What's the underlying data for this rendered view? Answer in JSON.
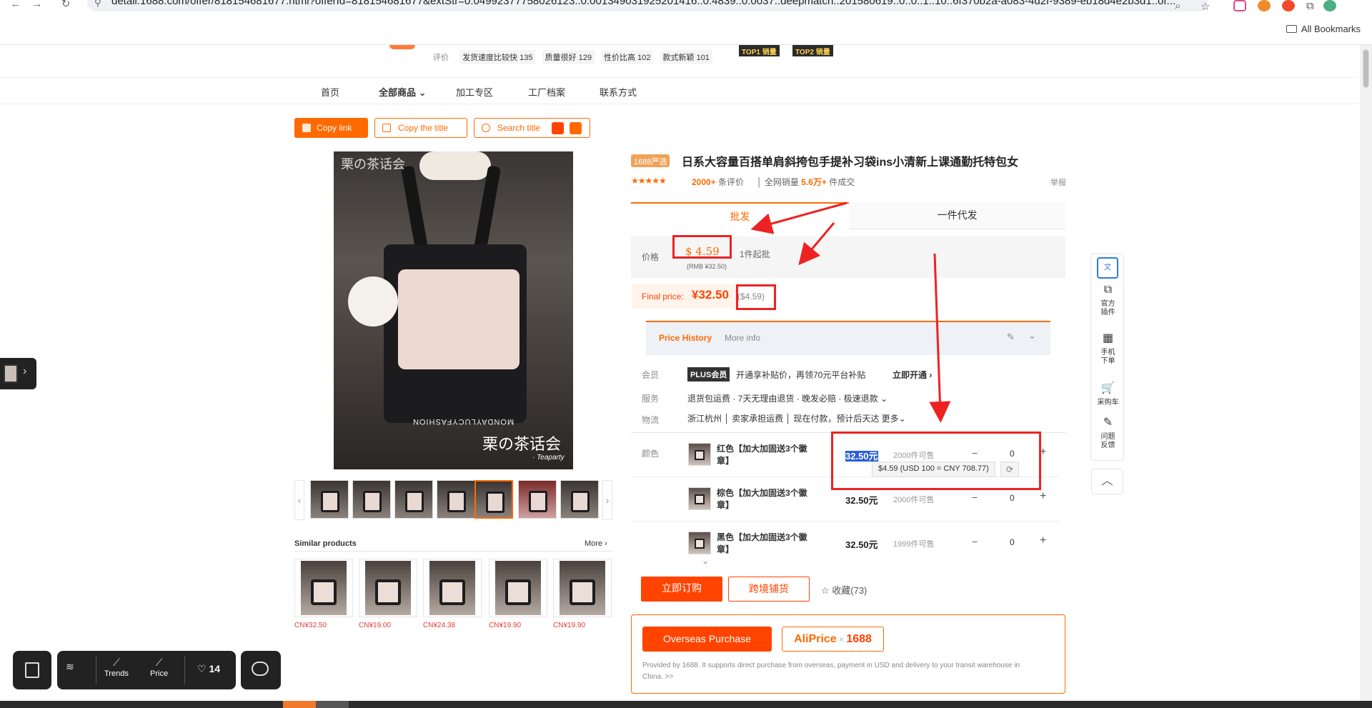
{
  "browser": {
    "url": "detail.1688.com/offer/818154681677.html?offerId=818154681677&extStr=0.04992377758026123..0.001349031925201416..0.4839..0.0037..deepmatch..201580619..0..0..1..10..6f370b2a-a083-4d2f-9389-eb18d4e2b3d1..of...",
    "bookmarks_label": "All Bookmarks"
  },
  "store": {
    "rating_label": "评价",
    "chips": [
      "发货速度比较快 135",
      "质量很好 129",
      "性价比高 102",
      "款式新颖 101"
    ],
    "top_badges": [
      "TOP1 销量",
      "TOP2 销量"
    ],
    "nav": [
      "首页",
      "全部商品",
      "加工专区",
      "工厂档案",
      "联系方式"
    ]
  },
  "toolbar": {
    "copy_link": "Copy link",
    "copy_title": "Copy the title",
    "search_title": "Search title"
  },
  "product": {
    "badge": "1688严选",
    "title": "日系大容量百搭单肩斜挎包手提补习袋ins小清新上课通勤托特包女",
    "stars": "★★★★★",
    "review_count": "2000+",
    "review_suffix": " 条评价",
    "sales_prefix": "全网销量 ",
    "sales_count": "5.6万+",
    "sales_suffix": " 件成交",
    "report": "举报"
  },
  "image": {
    "watermark_top": "栗の茶话会",
    "watermark_main": "栗の茶话会",
    "watermark_sub": "· Teaparty",
    "brand_text": "MONDAYLUCYFASHION"
  },
  "tabs": {
    "wholesale": "批发",
    "dropship": "一件代发"
  },
  "price": {
    "label": "价格",
    "usd": "$ 4.59",
    "rmb_note": "(RMB ¥32.50)",
    "moq": "1件起批",
    "final_label": "Final price:",
    "final_cny": "¥32.50",
    "final_usd": "($4.59)"
  },
  "history": {
    "tab1": "Price History",
    "tab2": "More info"
  },
  "rows": {
    "member_label": "会员",
    "member_badge": "PLUS会员",
    "member_text": "开通享补贴价，再领70元平台补贴",
    "member_cta": "立即开通 ›",
    "service_label": "服务",
    "service_text": "退货包运费 · 7天无理由退货 · 晚发必赔 · 极速退款 ⌄",
    "logistics_label": "物流",
    "logistics_text": "浙江杭州 │ 卖家承担运费 │ 现在付款，预计后天达  更多⌄",
    "color_label": "颜色"
  },
  "skus": [
    {
      "name": "红色【加大加固送3个徽章】",
      "price": "32.50元",
      "stock": "2000件可售",
      "qty": "0"
    },
    {
      "name": "棕色【加大加固送3个徽章】",
      "price": "32.50元",
      "stock": "2000件可售",
      "qty": "0"
    },
    {
      "name": "黑色【加大加固送3个徽章】",
      "price": "32.50元",
      "stock": "1999件可售",
      "qty": "0"
    }
  ],
  "tooltip": "$4.59 (USD 100 = CNY 708.77)",
  "actions": {
    "buy": "立即订购",
    "cross": "跨境铺货",
    "fav": "☆ 收藏(73)"
  },
  "overseas": {
    "button": "Overseas Purchase",
    "logo_a": "AliPrice",
    "logo_x": " × ",
    "logo_n": "1688",
    "desc": "Provided by 1688. It supports direct purchase from overseas, payment in USD and delivery to your transit warehouse in China. >>"
  },
  "similar": {
    "title": "Similar products",
    "more": "More ›",
    "prices": [
      "CN¥32.50",
      "CN¥19.00",
      "CN¥24.38",
      "CN¥19.90",
      "CN¥19.90"
    ]
  },
  "widgets": {
    "trends": "Trends",
    "price": "Price",
    "favorites": "14"
  },
  "rightbar": {
    "plugin": "官方插件",
    "mobile": "手机下单",
    "cart": "采购车",
    "feedback": "问题反馈"
  }
}
